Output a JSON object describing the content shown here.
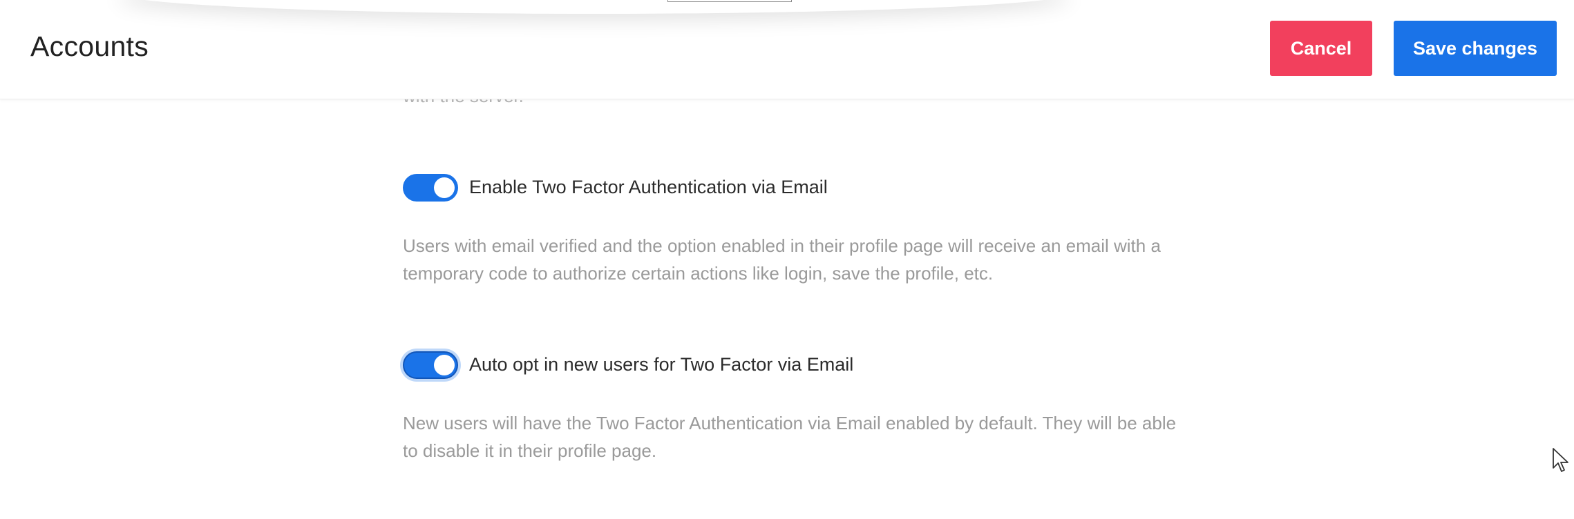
{
  "header": {
    "title": "Accounts",
    "cancel_label": "Cancel",
    "save_label": "Save changes"
  },
  "content": {
    "partial_text": "with the server.",
    "settings": [
      {
        "label": "Enable Two Factor Authentication via Email",
        "enabled": true,
        "description": "Users with email verified and the option enabled in their profile page will receive an email with a temporary code to authorize certain actions like login, save the profile, etc."
      },
      {
        "label": "Auto opt in new users for Two Factor via Email",
        "enabled": true,
        "focused": true,
        "description": "New users will have the Two Factor Authentication via Email enabled by default. They will be able to disable it in their profile page."
      }
    ]
  },
  "colors": {
    "cancel": "#f2405d",
    "primary": "#1a73e8",
    "title_text": "#222222",
    "label_text": "#2b2b2b",
    "description_text": "#9a9a9a"
  },
  "icons": {
    "cursor": "mouse-pointer-icon"
  }
}
